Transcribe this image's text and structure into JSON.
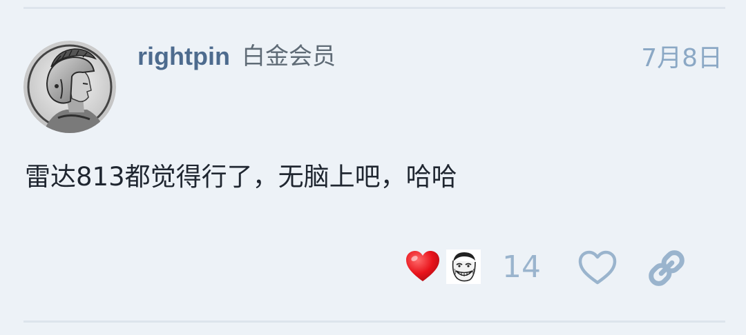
{
  "post": {
    "username": "rightpin",
    "user_title": "白金会员",
    "date": "7月8日",
    "body": "雷达813都觉得行了，无脑上吧，哈哈"
  },
  "reactions": {
    "count": "14",
    "emojis": [
      "heart",
      "troll-face"
    ]
  },
  "actions": {
    "like_icon": "heart-outline-icon",
    "share_icon": "link-icon"
  },
  "colors": {
    "background": "#edf2f7",
    "username": "#4d6b8e",
    "date": "#8ba8c5",
    "count": "#9ab4cd",
    "heart_red": "#e8131b",
    "icon_blue": "#9ab4cd"
  }
}
